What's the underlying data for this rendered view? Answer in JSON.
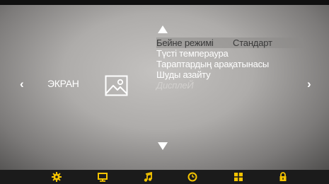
{
  "nav": {
    "left_arrow": "‹",
    "right_arrow": "›"
  },
  "category": {
    "label": "ЭКРАН",
    "icon": "picture-icon"
  },
  "menu": {
    "items": [
      {
        "label": "Бейне режимі",
        "value": "Стандарт",
        "selected": true
      },
      {
        "label": "Түсті темпераура"
      },
      {
        "label": "Тараптардың арақатынасы"
      },
      {
        "label": "Шуды азайту"
      },
      {
        "label": "ДисплеЙ",
        "disabled": true
      }
    ]
  },
  "bottom_bar": {
    "icons": [
      "settings-icon",
      "monitor-icon",
      "music-icon",
      "clock-icon",
      "apps-grid-icon",
      "lock-icon"
    ],
    "accent_color": "#f5c400"
  }
}
